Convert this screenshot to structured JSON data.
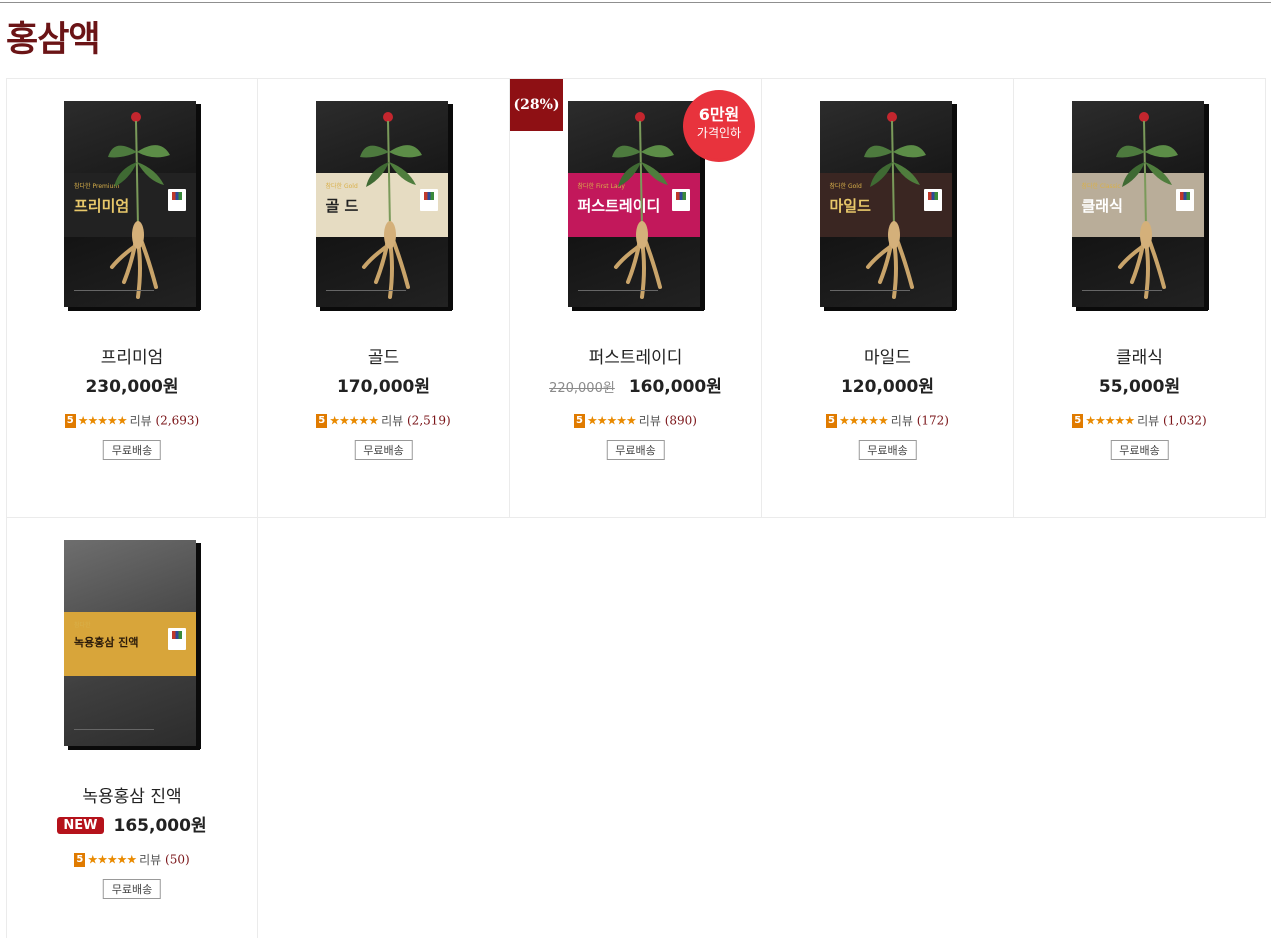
{
  "page": {
    "title": "홍삼액"
  },
  "colors": {
    "title": "#6b1416",
    "discount_tag": "#8e1014",
    "new_badge": "#b5121b",
    "score_badge": "#e07b00",
    "stars": "#e98a00",
    "price_cut_badge": "#e8333d"
  },
  "products": [
    {
      "name": "프리미엄",
      "price": "230,000원",
      "rating_score": "5",
      "stars": "★★★★★",
      "review_label": "리뷰",
      "review_count": "(2,693)",
      "shipping": "무료배송",
      "box_label": "프리미엄",
      "box_sub": "참다한 Premium",
      "band_color": "#222222",
      "band_text_color": "#e8c86a"
    },
    {
      "name": "골드",
      "price": "170,000원",
      "rating_score": "5",
      "stars": "★★★★★",
      "review_label": "리뷰",
      "review_count": "(2,519)",
      "shipping": "무료배송",
      "box_label": "골 드",
      "box_sub": "참다한 Gold",
      "band_color": "#e6dcc2",
      "band_text_color": "#222222"
    },
    {
      "name": "퍼스트레이디",
      "old_price": "220,000원",
      "price": "160,000원",
      "rating_score": "5",
      "stars": "★★★★★",
      "review_label": "리뷰",
      "review_count": "(890)",
      "shipping": "무료배송",
      "discount": "(28%)",
      "price_cut_main": "6만원",
      "price_cut_sub": "가격인하",
      "box_label": "퍼스트레이디",
      "box_sub": "참다한 First Lady",
      "band_color": "#c2185b",
      "band_text_color": "#ffffff"
    },
    {
      "name": "마일드",
      "price": "120,000원",
      "rating_score": "5",
      "stars": "★★★★★",
      "review_label": "리뷰",
      "review_count": "(172)",
      "shipping": "무료배송",
      "box_label": "마일드",
      "box_sub": "참다한 Gold",
      "band_color": "#3a2622",
      "band_text_color": "#e8c86a"
    },
    {
      "name": "클래식",
      "price": "55,000원",
      "rating_score": "5",
      "stars": "★★★★★",
      "review_label": "리뷰",
      "review_count": "(1,032)",
      "shipping": "무료배송",
      "box_label": "클래식",
      "box_sub": "참다한 Classic",
      "band_color": "#b9ad99",
      "band_text_color": "#ffffff"
    },
    {
      "name": "녹용홍삼 진액",
      "price": "165,000원",
      "new_badge": "NEW",
      "rating_score": "5",
      "stars": "★★★★★",
      "review_label": "리뷰",
      "review_count": "(50)",
      "shipping": "무료배송",
      "box_label": "녹용홍삼 진액",
      "box_sub": "참다한",
      "band_color": "#d8a53a",
      "band_text_color": "#2a1a0a"
    }
  ]
}
